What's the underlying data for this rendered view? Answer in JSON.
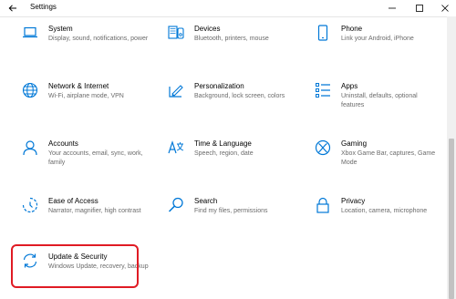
{
  "window": {
    "title": "Settings"
  },
  "colors": {
    "accent": "#0078d7",
    "highlight": "#e01b24"
  },
  "tiles": [
    {
      "name": "System",
      "desc": "Display, sound, notifications, power",
      "icon": "laptop-icon"
    },
    {
      "name": "Devices",
      "desc": "Bluetooth, printers, mouse",
      "icon": "devices-icon"
    },
    {
      "name": "Phone",
      "desc": "Link your Android, iPhone",
      "icon": "phone-icon"
    },
    {
      "name": "Network & Internet",
      "desc": "Wi-Fi, airplane mode, VPN",
      "icon": "globe-icon"
    },
    {
      "name": "Personalization",
      "desc": "Background, lock screen, colors",
      "icon": "paint-icon"
    },
    {
      "name": "Apps",
      "desc": "Uninstall, defaults, optional features",
      "icon": "apps-list-icon"
    },
    {
      "name": "Accounts",
      "desc": "Your accounts, email, sync, work, family",
      "icon": "person-icon"
    },
    {
      "name": "Time & Language",
      "desc": "Speech, region, date",
      "icon": "time-language-icon"
    },
    {
      "name": "Gaming",
      "desc": "Xbox Game Bar, captures, Game Mode",
      "icon": "xbox-icon"
    },
    {
      "name": "Ease of Access",
      "desc": "Narrator, magnifier, high contrast",
      "icon": "ease-of-access-icon"
    },
    {
      "name": "Search",
      "desc": "Find my files, permissions",
      "icon": "search-icon"
    },
    {
      "name": "Privacy",
      "desc": "Location, camera, microphone",
      "icon": "lock-icon"
    },
    {
      "name": "Update & Security",
      "desc": "Windows Update, recovery, backup",
      "icon": "sync-icon"
    }
  ]
}
